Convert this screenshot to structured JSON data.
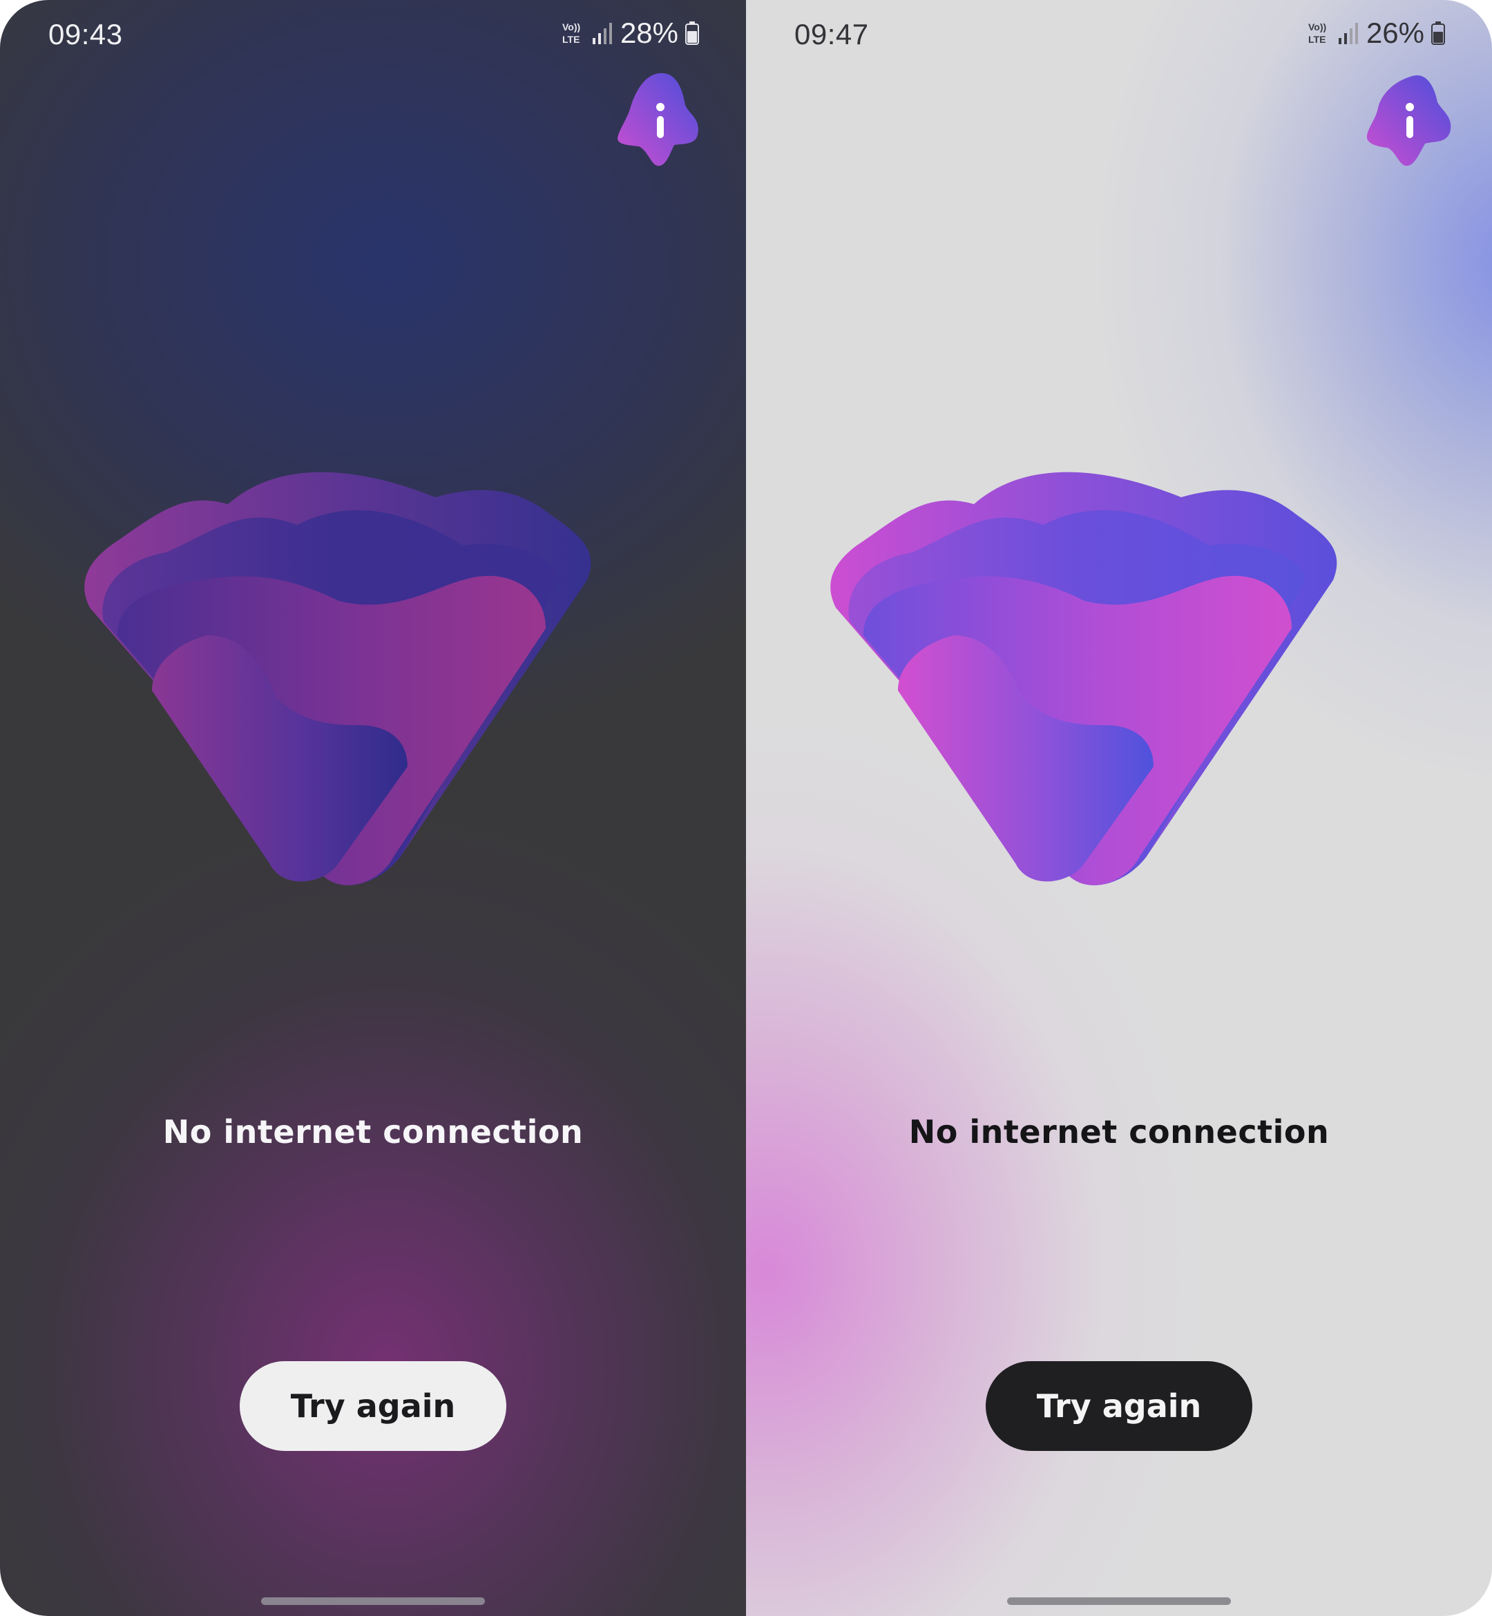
{
  "screens": {
    "dark": {
      "theme": "dark",
      "status": {
        "time": "09:43",
        "network": "Vo)) LTE",
        "battery": "28%"
      },
      "message": "No internet connection",
      "button_label": "Try again"
    },
    "light": {
      "theme": "light",
      "status": {
        "time": "09:47",
        "network": "Vo)) LTE",
        "battery": "26%"
      },
      "message": "No internet connection",
      "button_label": "Try again"
    }
  },
  "icons": {
    "info": "info-blob-icon",
    "logo": "heart-wifi-logo",
    "volte": "volte-icon",
    "signal": "signal-icon",
    "battery": "battery-icon"
  },
  "colors": {
    "brand_magenta": "#c84fcf",
    "brand_indigo": "#4b4ddb",
    "brand_violet": "#7a4ed8",
    "dark_bg": "#39393b",
    "light_bg": "#dcdcdd"
  }
}
